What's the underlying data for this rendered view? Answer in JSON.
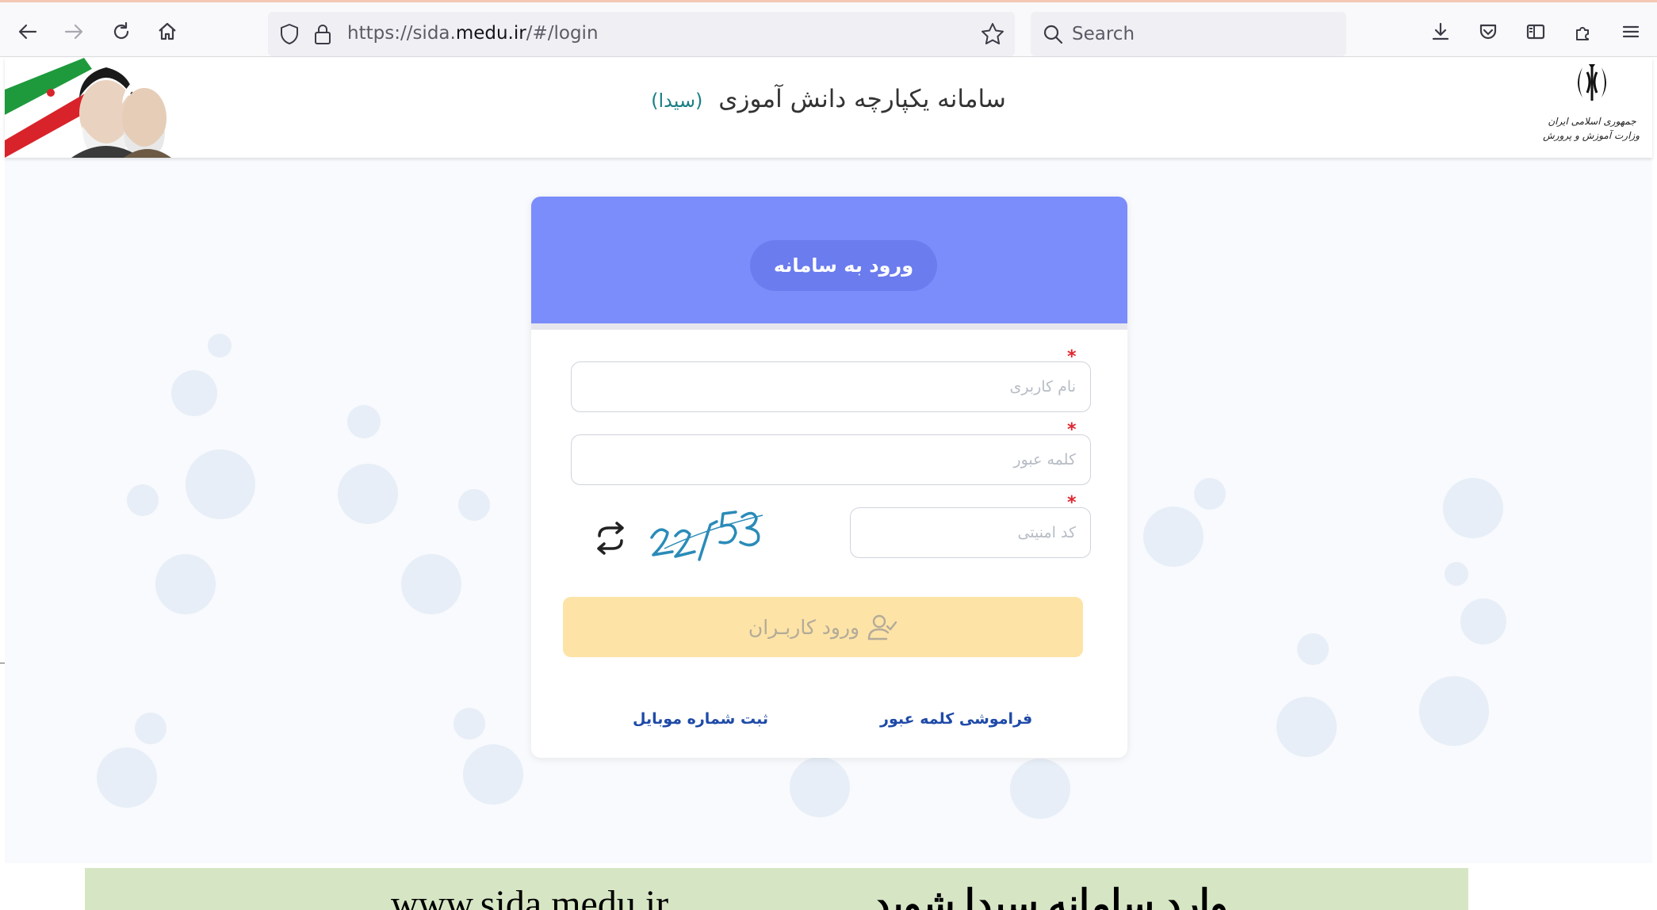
{
  "browser": {
    "url_prefix": "https://sida.",
    "url_domain": "medu.ir",
    "url_suffix": "/#/login",
    "search_placeholder": "Search",
    "icons": [
      "back-arrow-icon",
      "forward-arrow-icon",
      "reload-icon",
      "home-icon",
      "shield-icon",
      "lock-icon",
      "star-icon",
      "search-icon",
      "download-icon",
      "pocket-icon",
      "sidebar-icon",
      "extensions-icon",
      "menu-icon"
    ]
  },
  "header": {
    "title": "سامانه یکپارچه دانش آموزی",
    "title_accent": "(سیدا)",
    "logo_line1": "جمهوری اسلامی ایران",
    "logo_line2": "وزارت آموزش و پرورش"
  },
  "login": {
    "card_title": "ورود به سامانه",
    "username_placeholder": "نام کاربری",
    "password_placeholder": "کلمه عبور",
    "captcha_placeholder": "کد امنیتی",
    "captcha_text": "22153",
    "login_button_label": "ورود کاربـران",
    "forgot_password_link": "فراموشی کلمه عبور",
    "register_mobile_link": "ثبت شماره موبایل",
    "required_marker": "*"
  },
  "banner": {
    "persian_text": "وارد سامانه سیدا شوید",
    "url_text": "www.sida.medu.ir"
  },
  "colors": {
    "card_header": "#7b8cfb",
    "login_button": "#fde3a6",
    "banner_bg": "#d6e6c4",
    "link": "#1e4aa8",
    "accent": "#1a7f86"
  }
}
